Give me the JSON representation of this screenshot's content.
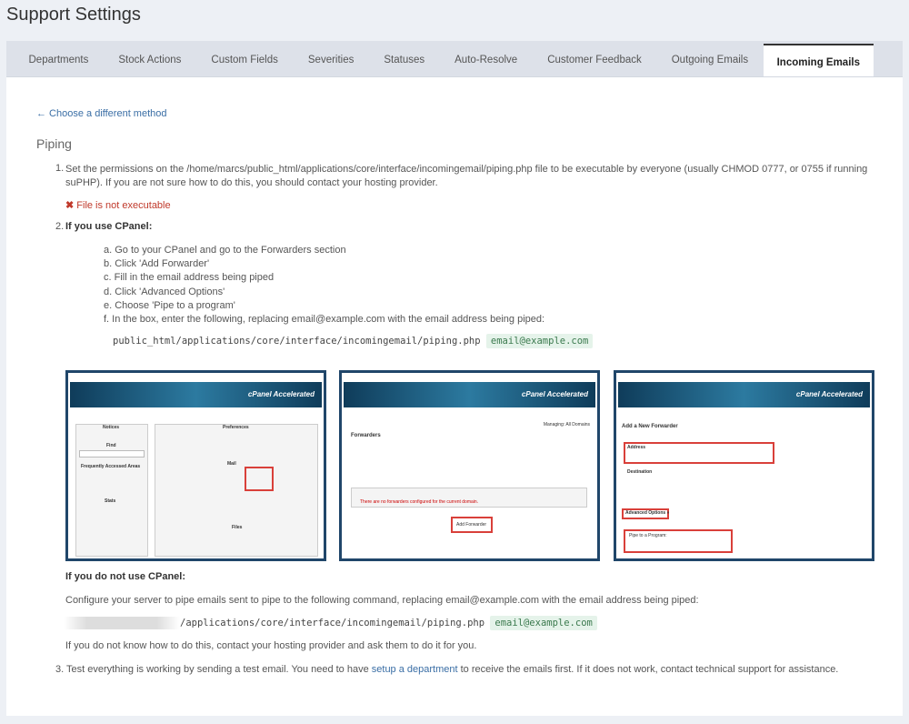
{
  "page_title": "Support Settings",
  "tabs": [
    "Departments",
    "Stock Actions",
    "Custom Fields",
    "Severities",
    "Statuses",
    "Auto-Resolve",
    "Customer Feedback",
    "Outgoing Emails",
    "Incoming Emails"
  ],
  "active_tab": "Incoming Emails",
  "back_link": "← Choose a different method",
  "section_title": "Piping",
  "step1": {
    "number": "1.",
    "text": "Set the permissions on the /home/marcs/public_html/applications/core/interface/incomingemail/piping.php file to be executable by everyone (usually CHMOD 0777, or 0755 if running suPHP). If you are not sure how to do this, you should contact your hosting provider.",
    "error": "File is not executable",
    "error_color": "#c0392b"
  },
  "step2": {
    "number": "2.",
    "heading": "If you use CPanel:",
    "substeps": [
      "a. Go to your CPanel and go to the Forwarders section",
      "b. Click 'Add Forwarder'",
      "c. Fill in the email address being piped",
      "d. Click 'Advanced Options'",
      "e. Choose 'Pipe to a program'",
      "f. In the box, enter the following, replacing email@example.com with the email address being piped:"
    ],
    "code_path": "public_html/applications/core/interface/incomingemail/piping.php",
    "code_email": "email@example.com",
    "screenshots": [
      {
        "brand": "cPanel Accelerated",
        "sections": [
          "Notices",
          "Find",
          "Frequently Accessed Areas",
          "Stats",
          "Preferences",
          "Mail",
          "Files"
        ],
        "highlight": "Forwarders"
      },
      {
        "brand": "cPanel Accelerated",
        "title": "Forwarders",
        "managing": "Managing: All Domains",
        "button": "Add Forwarder",
        "empty": "There are no forwarders configured for the current domain."
      },
      {
        "brand": "cPanel Accelerated",
        "title": "Add a New Forwarder",
        "labels": [
          "Address",
          "Destination",
          "Advanced Options »",
          "Pipe to a Program:"
        ]
      }
    ],
    "no_cpanel_heading": "If you do not use CPanel:",
    "no_cpanel_text": "Configure your server to pipe emails sent to pipe to the following command, replacing email@example.com with the email address being piped:",
    "no_cpanel_code": "/applications/core/interface/incomingemail/piping.php",
    "no_cpanel_email": "email@example.com",
    "no_cpanel_help": "If you do not know how to do this, contact your hosting provider and ask them to do it for you."
  },
  "step3": {
    "number": "3.",
    "before": "Test everything is working by sending a test email. You need to have ",
    "link": "setup a department",
    "after": " to receive the emails first. If it does not work, contact technical support for assistance."
  }
}
